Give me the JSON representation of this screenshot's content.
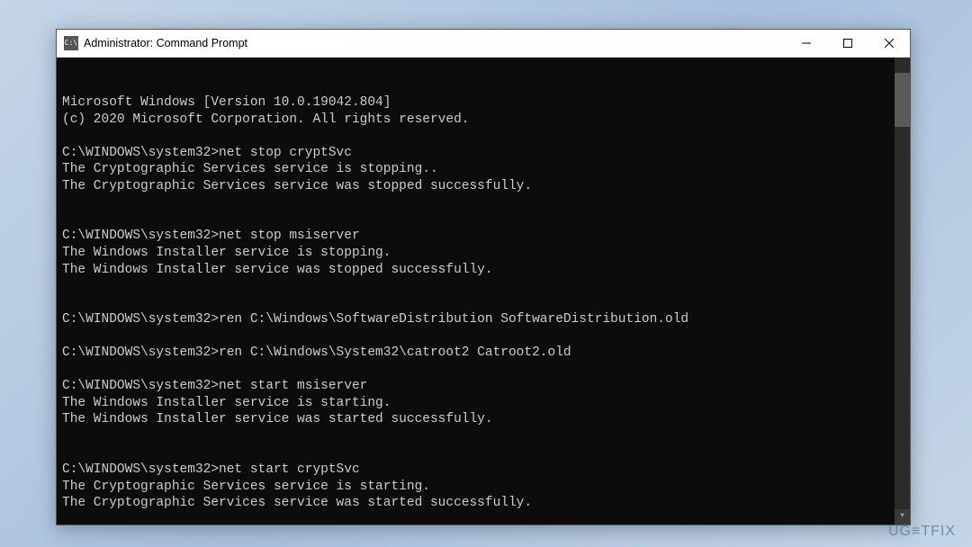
{
  "window": {
    "title": "Administrator: Command Prompt",
    "icon_label": "C:\\"
  },
  "terminal": {
    "lines": [
      "Microsoft Windows [Version 10.0.19042.804]",
      "(c) 2020 Microsoft Corporation. All rights reserved.",
      "",
      "C:\\WINDOWS\\system32>net stop cryptSvc",
      "The Cryptographic Services service is stopping..",
      "The Cryptographic Services service was stopped successfully.",
      "",
      "",
      "C:\\WINDOWS\\system32>net stop msiserver",
      "The Windows Installer service is stopping.",
      "The Windows Installer service was stopped successfully.",
      "",
      "",
      "C:\\WINDOWS\\system32>ren C:\\Windows\\SoftwareDistribution SoftwareDistribution.old",
      "",
      "C:\\WINDOWS\\system32>ren C:\\Windows\\System32\\catroot2 Catroot2.old",
      "",
      "C:\\WINDOWS\\system32>net start msiserver",
      "The Windows Installer service is starting.",
      "The Windows Installer service was started successfully.",
      "",
      "",
      "C:\\WINDOWS\\system32>net start cryptSvc",
      "The Cryptographic Services service is starting.",
      "The Cryptographic Services service was started successfully.",
      "",
      ""
    ]
  },
  "watermark": {
    "text": "UG≡TFIX"
  }
}
